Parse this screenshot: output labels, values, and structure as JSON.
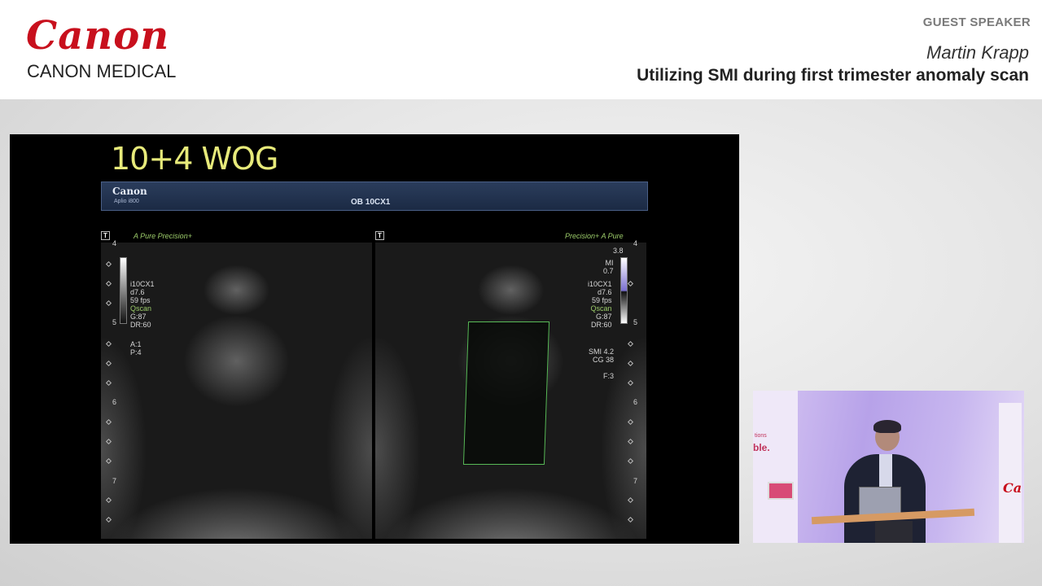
{
  "header": {
    "brand_wordmark": "Canon",
    "brand_sub": "CANON MEDICAL",
    "guest_label": "GUEST SPEAKER",
    "speaker_name": "Martin Krapp",
    "talk_title": "Utilizing SMI during first trimester anomaly scan"
  },
  "slide": {
    "title": "10+4 WOG",
    "us_brand": "Canon",
    "us_model": "Aplio i800",
    "us_preset": "OB 10CX1"
  },
  "left_pane": {
    "t_marker": "T",
    "mode_label": "A Pure  Precision+",
    "readout_lines": [
      "i10CX1",
      "d7.6",
      "59 fps",
      "Qscan",
      "G:87",
      "DR:60"
    ],
    "readout2_lines": [
      "A:1",
      "P:4"
    ],
    "depth_marks": [
      "4",
      "5",
      "6",
      "7"
    ]
  },
  "right_pane": {
    "t_marker": "T",
    "mode_label": "Precision+  A Pure",
    "scale_top": "3.8",
    "mi_lines": [
      "MI",
      "0.7"
    ],
    "readout_lines": [
      "i10CX1",
      "d7.6",
      "59 fps",
      "Qscan",
      "G:87",
      "DR:60"
    ],
    "smi_lines": [
      "SMI 4.2",
      "CG 38",
      "F:3"
    ],
    "depth_marks": [
      "4",
      "5",
      "6",
      "7"
    ]
  },
  "video_inset": {
    "backdrop_small": "tions",
    "backdrop_large": "ble.",
    "backdrop_brand": "Ca"
  },
  "colors": {
    "brand_red": "#c8101d",
    "slide_title": "#e7ea7a",
    "smi_roi": "#58b957"
  }
}
